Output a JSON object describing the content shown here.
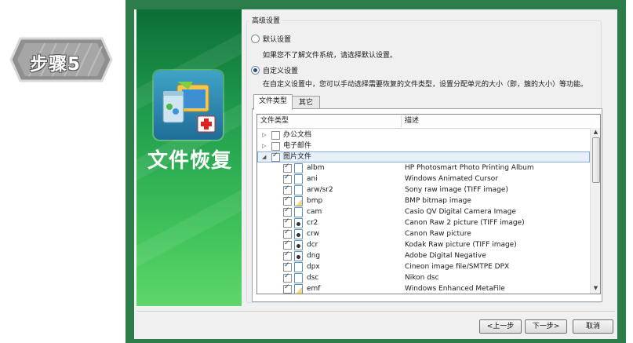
{
  "step": {
    "label": "步骤5"
  },
  "banner": {
    "title": "文件恢复",
    "icon": "file-recovery-icon"
  },
  "advanced": {
    "group_title": "高级设置",
    "default_option": {
      "label": "默认设置",
      "desc": "如果您不了解文件系统，请选择默认设置。",
      "selected": false
    },
    "custom_option": {
      "label": "自定义设置",
      "desc": "在自定义设置中，您可以手动选择需要恢复的文件类型，设置分配单元的大小（即，簇的大小）等功能。",
      "selected": true
    }
  },
  "tabs": [
    {
      "label": "文件类型",
      "active": true
    },
    {
      "label": "其它",
      "active": false
    }
  ],
  "list": {
    "columns": [
      "文件类型",
      "描述"
    ],
    "categories": [
      {
        "label": "办公文档",
        "checked": false,
        "expanded": false
      },
      {
        "label": "电子邮件",
        "checked": false,
        "expanded": false
      },
      {
        "label": "图片文件",
        "checked": true,
        "expanded": true
      }
    ],
    "items": [
      {
        "name": "albm",
        "desc": "HP Photosmart Photo Printing Album",
        "icon": "document-icon"
      },
      {
        "name": "ani",
        "desc": "Windows Animated Cursor",
        "icon": "document-icon"
      },
      {
        "name": "arw/sr2",
        "desc": "Sony raw image (TIFF image)",
        "icon": "document-icon"
      },
      {
        "name": "bmp",
        "desc": "BMP bitmap image",
        "icon": "image-icon"
      },
      {
        "name": "cam",
        "desc": "Casio QV Digital Camera Image",
        "icon": "document-icon"
      },
      {
        "name": "cr2",
        "desc": "Canon Raw 2 picture (TIFF image)",
        "icon": "camera-file-icon"
      },
      {
        "name": "crw",
        "desc": "Canon Raw picture",
        "icon": "camera-file-icon"
      },
      {
        "name": "dcr",
        "desc": "Kodak Raw picture (TIFF image)",
        "icon": "camera-file-icon"
      },
      {
        "name": "dng",
        "desc": "Adobe Digital Negative",
        "icon": "camera-file-icon"
      },
      {
        "name": "dpx",
        "desc": "Cineon image file/SMTPE DPX",
        "icon": "document-icon"
      },
      {
        "name": "dsc",
        "desc": "Nikon dsc",
        "icon": "document-icon"
      },
      {
        "name": "emf",
        "desc": "Windows Enhanced MetaFile",
        "icon": "image-icon"
      }
    ]
  },
  "buttons": {
    "back": "<上一步",
    "next": "下一步>",
    "cancel": "取消"
  },
  "colors": {
    "frame": "#2d7d4b",
    "banner_top": "#0c6e36",
    "banner_bottom": "#5fd66b",
    "selection": "#e6f1fb"
  }
}
